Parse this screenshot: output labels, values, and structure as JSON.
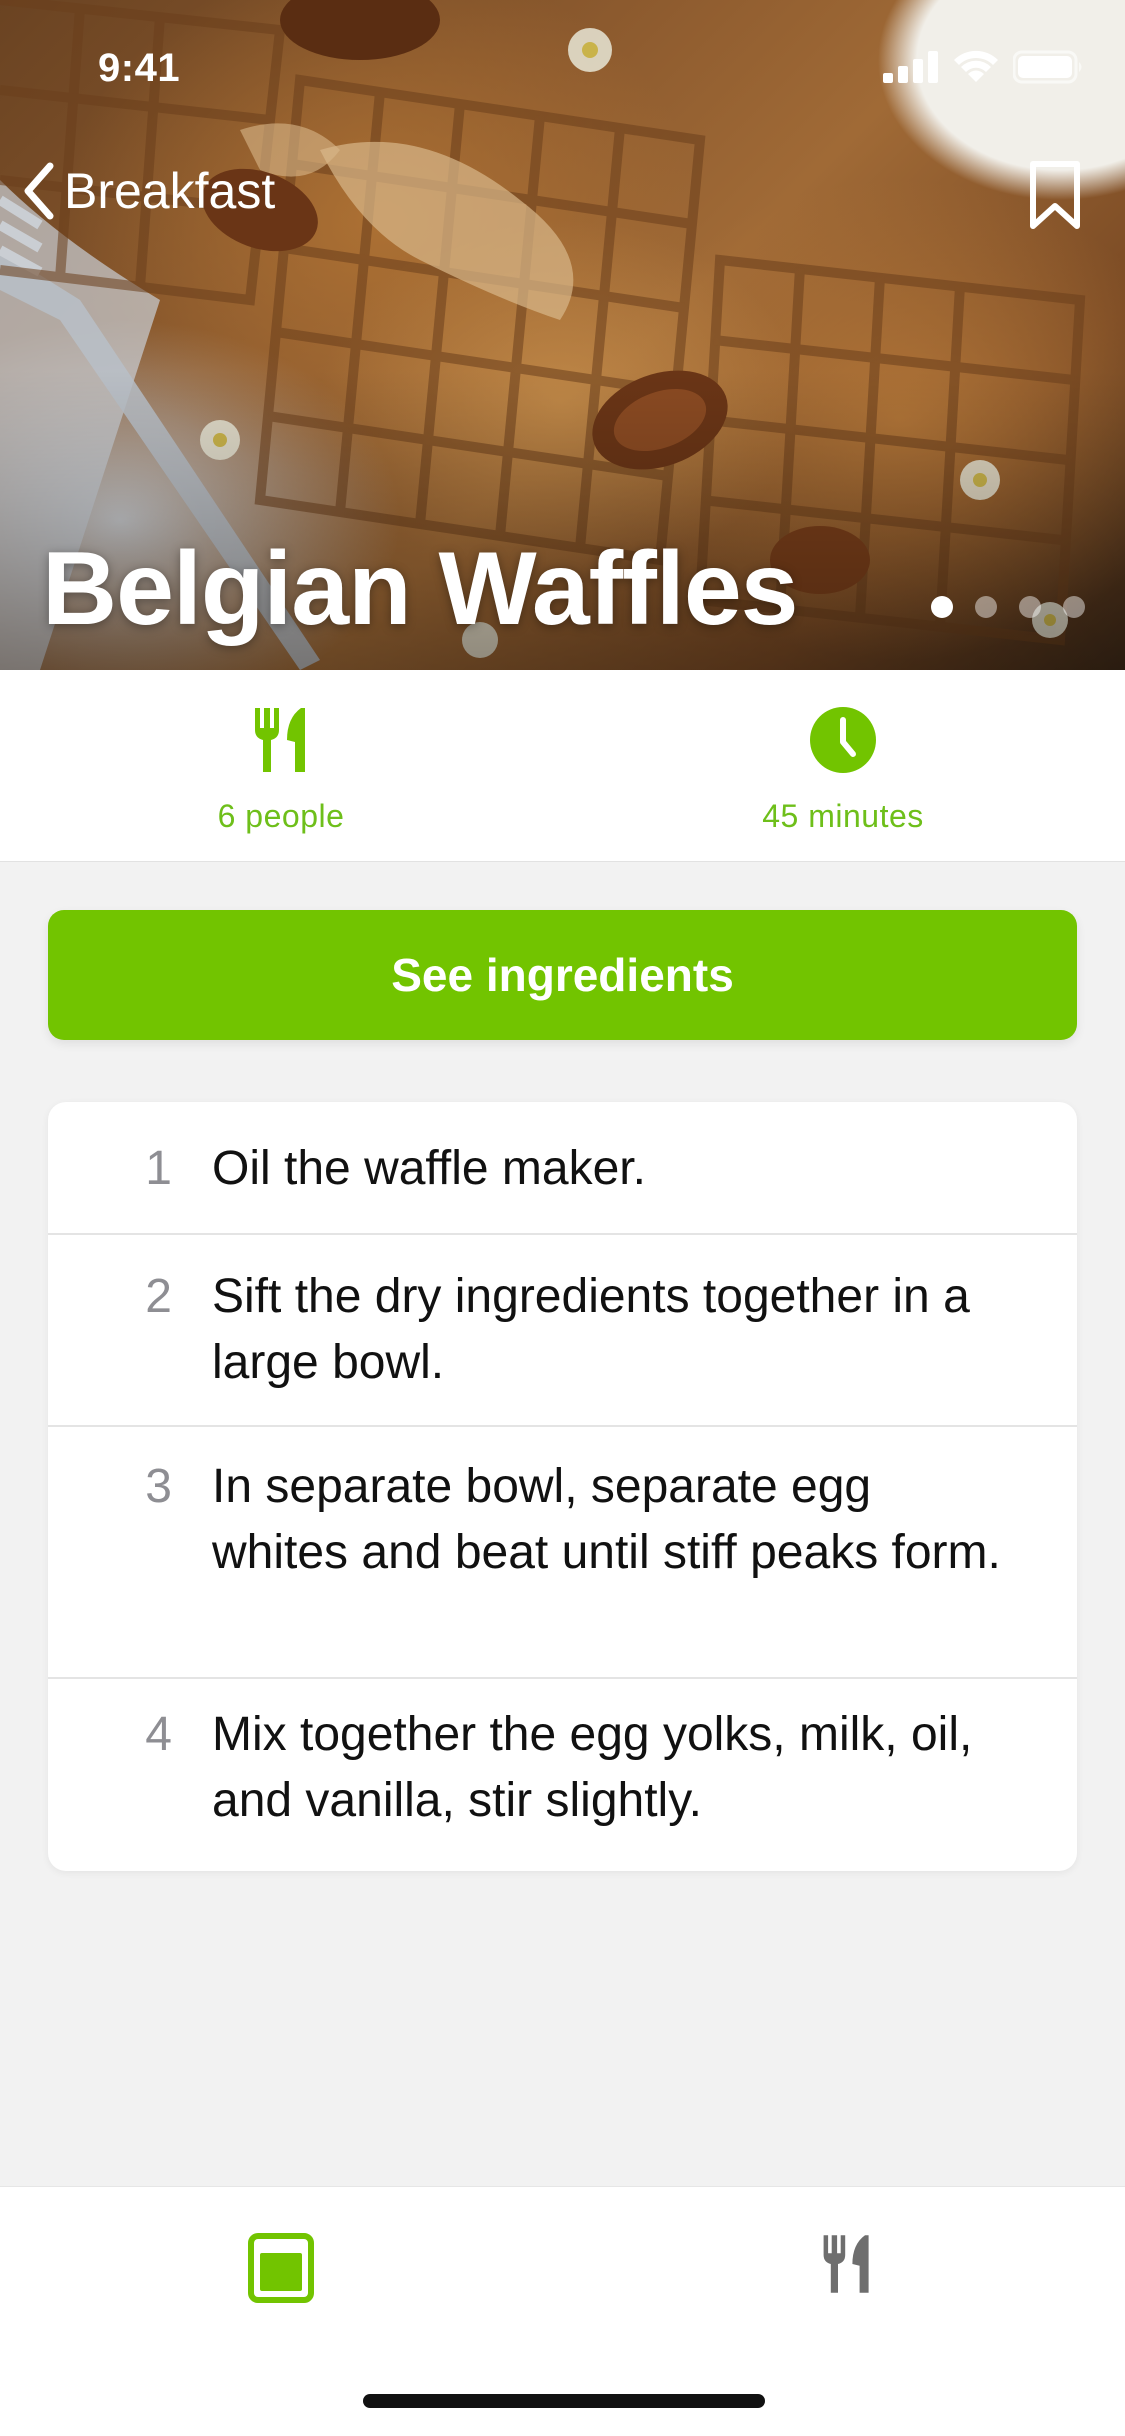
{
  "status_bar": {
    "time": "9:41"
  },
  "nav": {
    "back_label": "Breakfast"
  },
  "hero": {
    "title": "Belgian Waffles",
    "pager": {
      "count": 4,
      "active_index": 0
    }
  },
  "info": {
    "servings_label": "6 people",
    "time_label": "45 minutes"
  },
  "cta": {
    "label": "See ingredients"
  },
  "steps": [
    {
      "number": "1",
      "text": "Oil the waffle maker."
    },
    {
      "number": "2",
      "text": "Sift the dry ingredients together in a large bowl."
    },
    {
      "number": "3",
      "text": "In separate bowl, separate egg whites and beat until stiff peaks form."
    },
    {
      "number": "4",
      "text": "Mix together the egg yolks, milk, oil, and vanilla, stir slightly."
    }
  ],
  "tabs": [
    {
      "icon": "recipe-book-icon",
      "active": true
    },
    {
      "icon": "fork-knife-icon",
      "active": false
    }
  ],
  "colors": {
    "accent": "#72c400",
    "accent_text": "#6ebf1a",
    "inactive_tab": "#6e6e6e",
    "background": "#f2f2f2"
  }
}
